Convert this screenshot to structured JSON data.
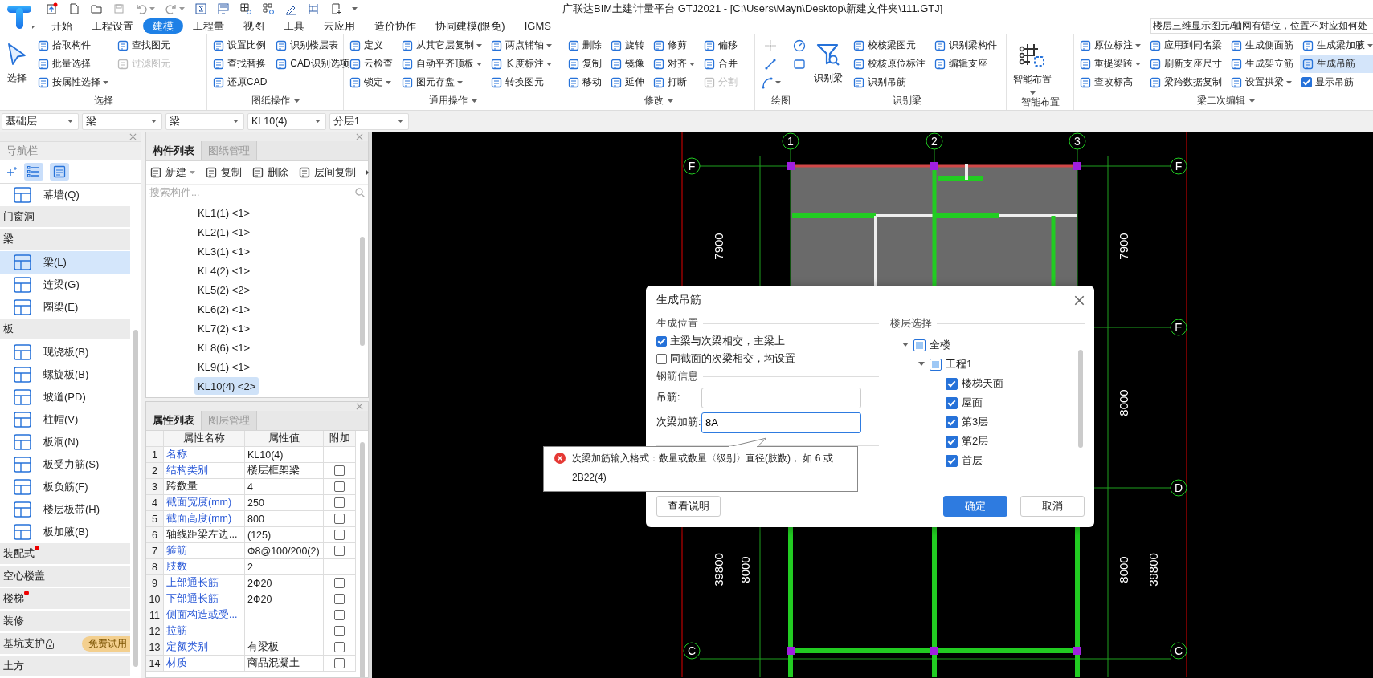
{
  "app": {
    "title": "广联达BIM土建计量平台 GTJ2021 - [C:\\Users\\Mayn\\Desktop\\新建文件夹\\111.GTJ]",
    "help_tip": "楼层三维显示图元/轴网有错位，位置不对应如何处"
  },
  "tabs": [
    {
      "label": "开始",
      "selected": false
    },
    {
      "label": "工程设置",
      "selected": false
    },
    {
      "label": "建模",
      "selected": true
    },
    {
      "label": "工程量",
      "selected": false
    },
    {
      "label": "视图",
      "selected": false
    },
    {
      "label": "工具",
      "selected": false
    },
    {
      "label": "云应用",
      "selected": false
    },
    {
      "label": "造价协作",
      "selected": false
    },
    {
      "label": "协同建模(限免)",
      "selected": false
    },
    {
      "label": "IGMS",
      "selected": false
    }
  ],
  "ribbon": {
    "groups": [
      {
        "label": "选择",
        "menu": false,
        "columns": [
          [
            {
              "kind": "big",
              "label": "选择",
              "dropdown": false
            }
          ],
          [
            {
              "kind": "button",
              "label": "拾取构件",
              "dropdown": false,
              "disabled": false
            },
            {
              "kind": "button",
              "label": "批量选择",
              "dropdown": false,
              "disabled": false
            },
            {
              "kind": "button",
              "label": "按属性选择",
              "dropdown": true,
              "disabled": false
            }
          ],
          [
            {
              "kind": "button",
              "label": "查找图元",
              "dropdown": false,
              "disabled": false
            },
            {
              "kind": "button",
              "label": "过滤图元",
              "dropdown": false,
              "disabled": true
            }
          ]
        ]
      },
      {
        "label": "图纸操作",
        "menu": true,
        "columns": [
          [
            {
              "kind": "button",
              "label": "设置比例",
              "dropdown": false,
              "disabled": false
            },
            {
              "kind": "button",
              "label": "查找替换",
              "dropdown": false,
              "disabled": false
            },
            {
              "kind": "button",
              "label": "还原CAD",
              "dropdown": false,
              "disabled": false
            }
          ],
          [
            {
              "kind": "button",
              "label": "识别楼层表",
              "dropdown": false,
              "disabled": false
            },
            {
              "kind": "button",
              "label": "CAD识别选项",
              "dropdown": false,
              "disabled": false
            }
          ]
        ]
      },
      {
        "label": "通用操作",
        "menu": true,
        "columns": [
          [
            {
              "kind": "button",
              "label": "定义",
              "dropdown": false,
              "disabled": false
            },
            {
              "kind": "button",
              "label": "云检查",
              "dropdown": false,
              "disabled": false
            },
            {
              "kind": "button",
              "label": "锁定",
              "dropdown": true,
              "disabled": false
            }
          ],
          [
            {
              "kind": "button",
              "label": "从其它层复制",
              "dropdown": true,
              "disabled": false
            },
            {
              "kind": "button",
              "label": "自动平齐顶板",
              "dropdown": true,
              "disabled": false
            },
            {
              "kind": "button",
              "label": "图元存盘",
              "dropdown": true,
              "disabled": false
            }
          ],
          [
            {
              "kind": "button",
              "label": "两点辅轴",
              "dropdown": true,
              "disabled": false
            },
            {
              "kind": "button",
              "label": "长度标注",
              "dropdown": true,
              "disabled": false
            },
            {
              "kind": "button",
              "label": "转换图元",
              "dropdown": false,
              "disabled": false
            }
          ]
        ]
      },
      {
        "label": "修改",
        "menu": true,
        "columns": [
          [
            {
              "kind": "button",
              "label": "删除",
              "dropdown": false,
              "disabled": false
            },
            {
              "kind": "button",
              "label": "复制",
              "dropdown": false,
              "disabled": false
            },
            {
              "kind": "button",
              "label": "移动",
              "dropdown": false,
              "disabled": false
            }
          ],
          [
            {
              "kind": "button",
              "label": "旋转",
              "dropdown": false,
              "disabled": false
            },
            {
              "kind": "button",
              "label": "镜像",
              "dropdown": false,
              "disabled": false
            },
            {
              "kind": "button",
              "label": "延伸",
              "dropdown": false,
              "disabled": false
            }
          ],
          [
            {
              "kind": "button",
              "label": "修剪",
              "dropdown": false,
              "disabled": false
            },
            {
              "kind": "button",
              "label": "对齐",
              "dropdown": true,
              "disabled": false
            },
            {
              "kind": "button",
              "label": "打断",
              "dropdown": false,
              "disabled": false
            }
          ],
          [
            {
              "kind": "button",
              "label": "偏移",
              "dropdown": false,
              "disabled": false
            },
            {
              "kind": "button",
              "label": "合并",
              "dropdown": false,
              "disabled": false
            },
            {
              "kind": "button",
              "label": "分割",
              "dropdown": false,
              "disabled": true
            }
          ]
        ]
      },
      {
        "label": "绘图",
        "menu": false,
        "columns": [
          [
            {
              "kind": "icon",
              "dropdown": false,
              "disabled": true
            },
            {
              "kind": "icon",
              "dropdown": false,
              "disabled": false
            },
            {
              "kind": "icon",
              "dropdown": true,
              "disabled": false
            }
          ],
          [
            {
              "kind": "icon",
              "dropdown": false,
              "disabled": false
            },
            {
              "kind": "icon",
              "dropdown": false,
              "disabled": false
            }
          ]
        ]
      },
      {
        "label": "识别梁",
        "menu": false,
        "columns": [
          [
            {
              "kind": "big",
              "label": "识别梁",
              "dropdown": false
            }
          ],
          [
            {
              "kind": "button",
              "label": "校核梁图元",
              "dropdown": false,
              "disabled": false
            },
            {
              "kind": "button",
              "label": "校核原位标注",
              "dropdown": false,
              "disabled": false
            },
            {
              "kind": "button",
              "label": "识别吊筋",
              "dropdown": false,
              "disabled": false
            }
          ],
          [
            {
              "kind": "button",
              "label": "识别梁构件",
              "dropdown": false,
              "disabled": false
            },
            {
              "kind": "button",
              "label": "编辑支座",
              "dropdown": false,
              "disabled": false
            }
          ]
        ]
      },
      {
        "label": "智能布置",
        "menu": false,
        "columns": [
          [
            {
              "kind": "big",
              "label": "智能布置",
              "dropdown": true
            }
          ]
        ]
      },
      {
        "label": "梁二次编辑",
        "menu": true,
        "columns": [
          [
            {
              "kind": "button",
              "label": "原位标注",
              "dropdown": true,
              "disabled": false
            },
            {
              "kind": "button",
              "label": "重提梁跨",
              "dropdown": true,
              "disabled": false
            },
            {
              "kind": "button",
              "label": "查改标高",
              "dropdown": false,
              "disabled": false
            }
          ],
          [
            {
              "kind": "button",
              "label": "应用到同名梁",
              "dropdown": false,
              "disabled": false
            },
            {
              "kind": "button",
              "label": "刷新支座尺寸",
              "dropdown": false,
              "disabled": false
            },
            {
              "kind": "button",
              "label": "梁跨数据复制",
              "dropdown": false,
              "disabled": false
            }
          ],
          [
            {
              "kind": "button",
              "label": "生成侧面筋",
              "dropdown": false,
              "disabled": false
            },
            {
              "kind": "button",
              "label": "生成架立筋",
              "dropdown": false,
              "disabled": false
            },
            {
              "kind": "button",
              "label": "设置拱梁",
              "dropdown": true,
              "disabled": false
            }
          ],
          [
            {
              "kind": "button",
              "label": "生成梁加腋",
              "dropdown": true,
              "disabled": false
            },
            {
              "kind": "toggle",
              "label": "生成吊筋",
              "on": true
            },
            {
              "kind": "checkbox",
              "label": "显示吊筋",
              "checked": true
            }
          ]
        ]
      }
    ]
  },
  "selectors": [
    "基础层",
    "梁",
    "梁",
    "KL10(4)",
    "分层1"
  ],
  "navigator": {
    "title": "导航栏",
    "items": [
      {
        "kind": "item",
        "label": "幕墙(Q)",
        "selected": false
      },
      {
        "kind": "category",
        "label": "门窗洞",
        "dot": false,
        "locked": false
      },
      {
        "kind": "category",
        "label": "梁",
        "dot": false,
        "locked": false
      },
      {
        "kind": "item",
        "label": "梁(L)",
        "selected": true
      },
      {
        "kind": "item",
        "label": "连梁(G)",
        "selected": false
      },
      {
        "kind": "item",
        "label": "圈梁(E)",
        "selected": false
      },
      {
        "kind": "category",
        "label": "板",
        "dot": false,
        "locked": false
      },
      {
        "kind": "item",
        "label": "现浇板(B)",
        "selected": false
      },
      {
        "kind": "item",
        "label": "螺旋板(B)",
        "selected": false
      },
      {
        "kind": "item",
        "label": "坡道(PD)",
        "selected": false
      },
      {
        "kind": "item",
        "label": "柱帽(V)",
        "selected": false
      },
      {
        "kind": "item",
        "label": "板洞(N)",
        "selected": false
      },
      {
        "kind": "item",
        "label": "板受力筋(S)",
        "selected": false
      },
      {
        "kind": "item",
        "label": "板负筋(F)",
        "selected": false
      },
      {
        "kind": "item",
        "label": "楼层板带(H)",
        "selected": false
      },
      {
        "kind": "item",
        "label": "板加腋(B)",
        "selected": false
      },
      {
        "kind": "category",
        "label": "装配式",
        "dot": true,
        "locked": false
      },
      {
        "kind": "category",
        "label": "空心楼盖",
        "dot": false,
        "locked": false
      },
      {
        "kind": "category",
        "label": "楼梯",
        "dot": true,
        "locked": false
      },
      {
        "kind": "category",
        "label": "装修",
        "dot": false,
        "locked": false
      },
      {
        "kind": "category",
        "label": "基坑支护",
        "dot": false,
        "locked": true,
        "tag": "免费试用"
      },
      {
        "kind": "category",
        "label": "土方",
        "dot": false,
        "locked": false
      }
    ]
  },
  "components": {
    "tabs": [
      {
        "label": "构件列表",
        "selected": true
      },
      {
        "label": "图纸管理",
        "selected": false
      }
    ],
    "toolbar": [
      {
        "label": "新建",
        "dropdown": true
      },
      {
        "label": "复制",
        "dropdown": false
      },
      {
        "label": "删除",
        "dropdown": false
      },
      {
        "label": "层间复制",
        "dropdown": false
      }
    ],
    "search": {
      "placeholder": "搜索构件..."
    },
    "items": [
      {
        "label": "KL1(1) <1>",
        "selected": false
      },
      {
        "label": "KL2(1) <1>",
        "selected": false
      },
      {
        "label": "KL3(1) <1>",
        "selected": false
      },
      {
        "label": "KL4(2) <1>",
        "selected": false
      },
      {
        "label": "KL5(2) <2>",
        "selected": false
      },
      {
        "label": "KL6(2) <1>",
        "selected": false
      },
      {
        "label": "KL7(2) <1>",
        "selected": false
      },
      {
        "label": "KL8(6) <1>",
        "selected": false
      },
      {
        "label": "KL9(1) <1>",
        "selected": false
      },
      {
        "label": "KL10(4) <2>",
        "selected": true
      }
    ]
  },
  "properties": {
    "tabs": [
      {
        "label": "属性列表",
        "selected": true
      },
      {
        "label": "图层管理",
        "selected": false
      }
    ],
    "columns": [
      "属性名称",
      "属性值",
      "附加"
    ],
    "rows": [
      {
        "index": "1",
        "name": "名称",
        "value": "KL10(4)",
        "public": true
      },
      {
        "index": "2",
        "name": "结构类别",
        "value": "楼层框架梁",
        "public": true,
        "checked": false
      },
      {
        "index": "3",
        "name": "跨数量",
        "value": "4",
        "public": false,
        "checked": false
      },
      {
        "index": "4",
        "name": "截面宽度(mm)",
        "value": "250",
        "public": true,
        "checked": false
      },
      {
        "index": "5",
        "name": "截面高度(mm)",
        "value": "800",
        "public": true,
        "checked": false
      },
      {
        "index": "6",
        "name": "轴线距梁左边...",
        "value": "(125)",
        "public": false,
        "checked": false
      },
      {
        "index": "7",
        "name": "箍筋",
        "value": "Ф8@100/200(2)",
        "public": true,
        "checked": false
      },
      {
        "index": "8",
        "name": "肢数",
        "value": "2",
        "public": true
      },
      {
        "index": "9",
        "name": "上部通长筋",
        "value": "2Ф20",
        "public": true,
        "checked": false
      },
      {
        "index": "10",
        "name": "下部通长筋",
        "value": "2Ф20",
        "public": true,
        "checked": false
      },
      {
        "index": "11",
        "name": "侧面构造或受...",
        "public": true,
        "checked": false
      },
      {
        "index": "12",
        "name": "拉筋",
        "public": true,
        "checked": false
      },
      {
        "index": "13",
        "name": "定额类别",
        "value": "有梁板",
        "public": true,
        "checked": false
      },
      {
        "index": "14",
        "name": "材质",
        "value": "商品混凝土",
        "public": true,
        "checked": false
      }
    ]
  },
  "canvas": {
    "labels": [
      {
        "kind": "axis",
        "label": "1"
      },
      {
        "kind": "axis",
        "label": "2"
      },
      {
        "kind": "axis",
        "label": "3"
      },
      {
        "kind": "axis",
        "label": "F"
      },
      {
        "kind": "axis",
        "label": "F"
      },
      {
        "kind": "axis",
        "label": "E"
      },
      {
        "kind": "axis",
        "label": "D"
      },
      {
        "kind": "axis",
        "label": "C"
      },
      {
        "kind": "axis",
        "label": "C"
      },
      {
        "kind": "dimension",
        "label": "7900"
      },
      {
        "kind": "dimension",
        "label": "7900"
      },
      {
        "kind": "dimension",
        "label": "8000"
      },
      {
        "kind": "dimension",
        "label": "39800"
      },
      {
        "kind": "dimension",
        "label": "8000"
      },
      {
        "kind": "dimension",
        "label": "8000"
      },
      {
        "kind": "dimension",
        "label": "39800"
      }
    ]
  },
  "dialog": {
    "title": "生成吊筋",
    "position": {
      "heading": "生成位置",
      "options": [
        {
          "label": "主梁与次梁相交，主梁上",
          "checked": true
        },
        {
          "label": "同截面的次梁相交，均设置",
          "checked": false
        }
      ]
    },
    "rebar": {
      "heading": "钢筋信息",
      "fields": [
        {
          "label": "吊筋:",
          "focused": false
        },
        {
          "label": "次梁加筋:",
          "value": "8A",
          "focused": true
        }
      ]
    },
    "floors": {
      "heading": "楼层选择",
      "tree": [
        {
          "label": "全楼",
          "partial": true,
          "expanded": true,
          "children": [
            {
              "label": "工程1",
              "partial": true,
              "expanded": true,
              "children": [
                {
                  "label": "楼梯天面",
                  "checked": true
                },
                {
                  "label": "屋面",
                  "checked": true
                },
                {
                  "label": "第3层",
                  "checked": true
                },
                {
                  "label": "第2层",
                  "checked": true
                },
                {
                  "label": "首层",
                  "checked": true
                }
              ]
            }
          ]
        }
      ]
    },
    "buttons": [
      {
        "label": "查看说明",
        "primary": false
      },
      {
        "label": "确定",
        "primary": true
      },
      {
        "label": "取消",
        "primary": false
      }
    ],
    "error": {
      "message": "次梁加筋输入格式：数量或数量〈级别〉直径(肢数)， 如 6 或 2B22(4)"
    }
  }
}
